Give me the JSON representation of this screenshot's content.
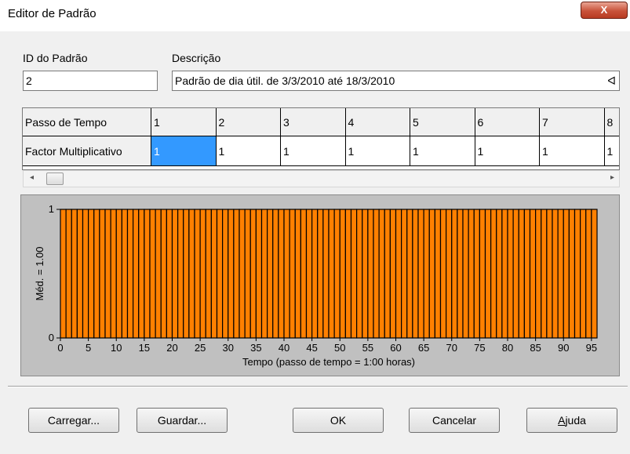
{
  "window": {
    "title": "Editor de Padrão",
    "close_label": "X"
  },
  "fields": {
    "id_label": "ID do Padrão",
    "id_value": "2",
    "desc_label": "Descrição",
    "desc_value": "Padrão de dia útil. de 3/3/2010 até 18/3/2010",
    "desc_trailing": "ᐊ"
  },
  "grid": {
    "row_headers": [
      "Passo de Tempo",
      "Factor Multiplicativo"
    ],
    "time_steps": [
      "1",
      "2",
      "3",
      "4",
      "5",
      "6",
      "7",
      "8"
    ],
    "multipliers": [
      "1",
      "1",
      "1",
      "1",
      "1",
      "1",
      "1",
      "1"
    ]
  },
  "scroll": {
    "left_arrow": "◂",
    "right_arrow": "▸"
  },
  "colors": {
    "bar_fill": "#ff8000",
    "bar_stroke": "#000000",
    "plot_bg": "#c0c0c0",
    "selection": "#3399ff"
  },
  "chart_data": {
    "type": "bar",
    "ylabel": "Méd. = 1.00",
    "xlabel": "Tempo (passo de tempo = 1:00 horas)",
    "ylim": [
      0,
      1
    ],
    "yticks": [
      "0",
      "1"
    ],
    "xticks": [
      "0",
      "5",
      "10",
      "15",
      "20",
      "25",
      "30",
      "35",
      "40",
      "45",
      "50",
      "55",
      "60",
      "65",
      "70",
      "75",
      "80",
      "85",
      "90",
      "95"
    ],
    "xlim": [
      0,
      96
    ],
    "values": [
      1,
      1,
      1,
      1,
      1,
      1,
      1,
      1,
      1,
      1,
      1,
      1,
      1,
      1,
      1,
      1,
      1,
      1,
      1,
      1,
      1,
      1,
      1,
      1,
      1,
      1,
      1,
      1,
      1,
      1,
      1,
      1,
      1,
      1,
      1,
      1,
      1,
      1,
      1,
      1,
      1,
      1,
      1,
      1,
      1,
      1,
      1,
      1,
      1,
      1,
      1,
      1,
      1,
      1,
      1,
      1,
      1,
      1,
      1,
      1,
      1,
      1,
      1,
      1,
      1,
      1,
      1,
      1,
      1,
      1,
      1,
      1,
      1,
      1,
      1,
      1,
      1,
      1,
      1,
      1,
      1,
      1,
      1,
      1,
      1,
      1,
      1,
      1,
      1,
      1,
      1,
      1,
      1,
      1,
      1,
      1
    ]
  },
  "buttons": {
    "load": "Carregar...",
    "save": "Guardar...",
    "ok": "OK",
    "cancel": "Cancelar",
    "help_prefix": "",
    "help_mnemonic": "A",
    "help_rest": "juda"
  }
}
